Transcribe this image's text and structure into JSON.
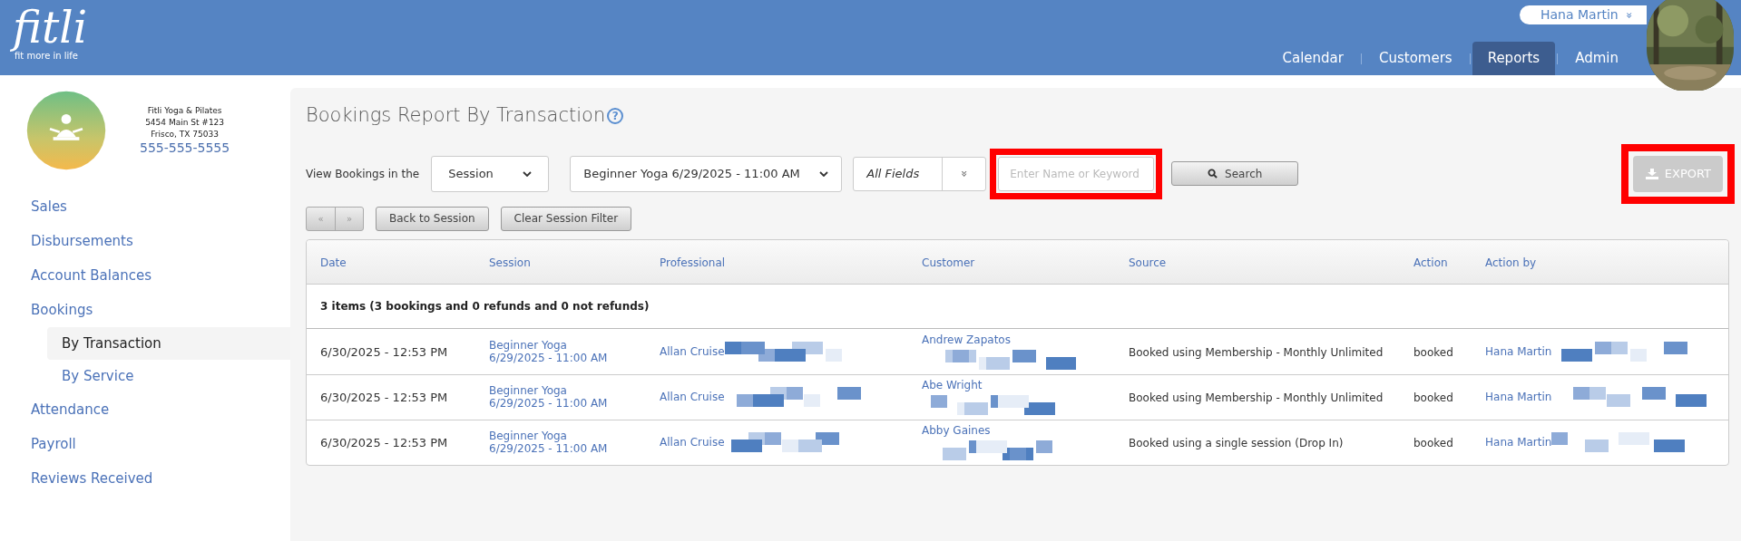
{
  "header": {
    "logo": "fitli",
    "tagline": "fit more in life",
    "user": "Hana Martin",
    "user_caret": "»",
    "nav": [
      {
        "label": "Calendar",
        "selected": false
      },
      {
        "label": "Customers",
        "selected": false
      },
      {
        "label": "Reports",
        "selected": true
      },
      {
        "label": "Admin",
        "selected": false
      }
    ]
  },
  "business": {
    "name": "Fitli Yoga & Pilates",
    "address": "5454 Main St #123",
    "city": "Frisco, TX 75033",
    "phone": "555-555-5555"
  },
  "sidebar": {
    "items": [
      {
        "label": "Sales",
        "selected": false
      },
      {
        "label": "Disbursements",
        "selected": false
      },
      {
        "label": "Account Balances",
        "selected": false
      },
      {
        "label": "Bookings",
        "selected": false,
        "children": [
          {
            "label": "By Transaction",
            "selected": true
          },
          {
            "label": "By Service",
            "selected": false
          }
        ]
      },
      {
        "label": "Attendance",
        "selected": false
      },
      {
        "label": "Payroll",
        "selected": false
      },
      {
        "label": "Reviews Received",
        "selected": false
      }
    ]
  },
  "page": {
    "title": "Bookings Report By Transaction",
    "help": "?",
    "filter_label": "View Bookings in the",
    "scope_select": "Session",
    "session_select": "Beginner Yoga 6/29/2025 - 11:00 AM",
    "field_select": "All Fields",
    "field_caret": "»",
    "search": {
      "placeholder": "Enter Name or Keyword",
      "highlighted": true
    },
    "search_button": "Search",
    "export": {
      "label": "EXPORT",
      "disabled": true,
      "highlighted": true
    },
    "pager": [
      "«",
      "»"
    ],
    "back_button": "Back to Session",
    "clear_button": "Clear Session Filter"
  },
  "table": {
    "columns": [
      "Date",
      "Session",
      "Professional",
      "Customer",
      "Source",
      "Action",
      "Action by"
    ],
    "summary": "3 items (3 bookings and 0 refunds and 0 not refunds)",
    "rows": [
      {
        "date": "6/30/2025 - 12:53 PM",
        "session": "Beginner Yoga",
        "session_time": "6/29/2025 - 11:00 AM",
        "professional": "Allan Cruise",
        "customer": "Andrew Zapatos",
        "source": "Booked using Membership - Monthly Unlimited",
        "action": "booked",
        "action_by": "Hana Martin"
      },
      {
        "date": "6/30/2025 - 12:53 PM",
        "session": "Beginner Yoga",
        "session_time": "6/29/2025 - 11:00 AM",
        "professional": "Allan Cruise",
        "customer": "Abe Wright",
        "source": "Booked using Membership - Monthly Unlimited",
        "action": "booked",
        "action_by": "Hana Martin"
      },
      {
        "date": "6/30/2025 - 12:53 PM",
        "session": "Beginner Yoga",
        "session_time": "6/29/2025 - 11:00 AM",
        "professional": "Allan Cruise",
        "customer": "Abby Gaines",
        "source": "Booked using a single session (Drop In)",
        "action": "booked",
        "action_by": "Hana Martin"
      }
    ]
  }
}
